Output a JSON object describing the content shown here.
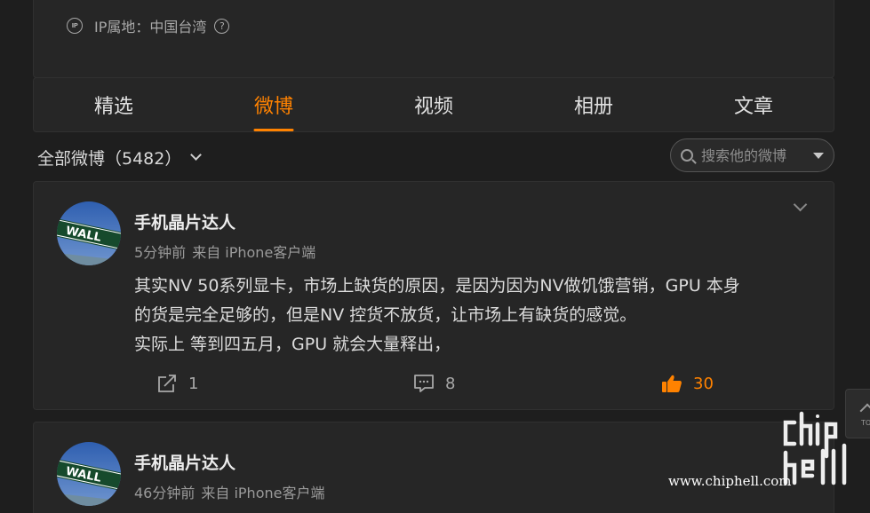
{
  "profile": {
    "ip_icon_text": "IP",
    "ip_location": "IP属地：中国台湾",
    "help_icon_text": "?"
  },
  "tabs": [
    {
      "label": "精选"
    },
    {
      "label": "微博",
      "active": true
    },
    {
      "label": "视频"
    },
    {
      "label": "相册"
    },
    {
      "label": "文章"
    }
  ],
  "filter": {
    "label": "全部微博（5482）"
  },
  "search": {
    "placeholder": "搜索他的微博"
  },
  "posts": [
    {
      "author": "手机晶片达人",
      "time": "5分钟前",
      "source": "来自 iPhone客户端",
      "lines": [
        "其实NV 50系列显卡，市场上缺货的原因，是因为因为NV做饥饿营销，GPU 本身",
        "的货是完全足够的，但是NV 控货不放货，让市场上有缺货的感觉。",
        "实际上 等到四五月，GPU 就会大量释出，"
      ],
      "reposts": "1",
      "comments": "8",
      "likes": "30",
      "liked": true,
      "avatar_text": "WALL"
    },
    {
      "author": "手机晶片达人",
      "time": "46分钟前",
      "source": "来自 iPhone客户端",
      "avatar_text": "WALL"
    }
  ],
  "back_to_top": {
    "label": "TO"
  },
  "watermark": {
    "url": "www.chiphell.com",
    "logo_text": "chiphell"
  },
  "colors": {
    "background": "#1e1e1e",
    "card": "#262626",
    "accent": "#ff8200",
    "text": "#dcdcdc",
    "muted": "#9a9a9a"
  },
  "icons": {
    "ip": "ip-circle-icon",
    "help": "question-circle-icon",
    "repost": "share-box-arrow-icon",
    "comment": "speech-bubble-icon",
    "like": "thumbs-up-icon",
    "search": "magnifier-icon"
  }
}
